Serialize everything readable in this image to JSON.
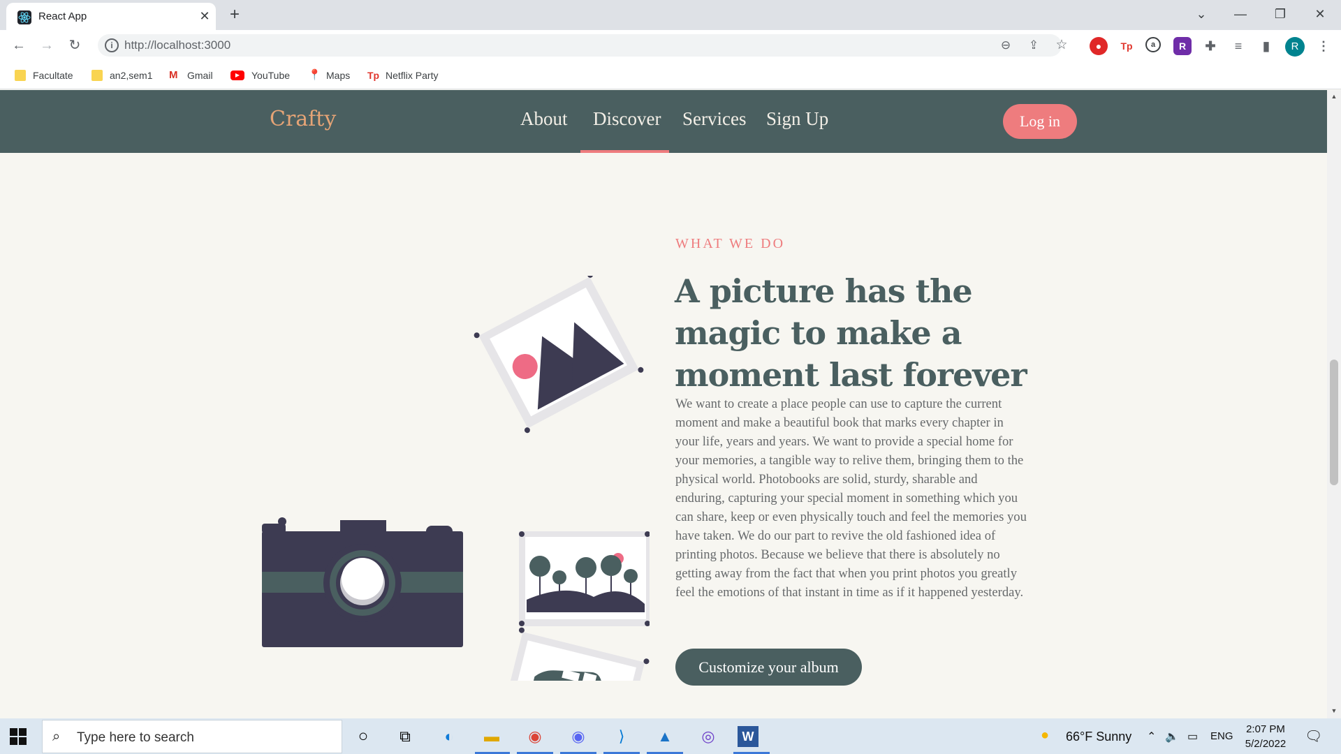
{
  "browser": {
    "tab_title": "React App",
    "url": "http://localhost:3000",
    "profile_initial": "R",
    "bookmarks": [
      "Facultate",
      "an2,sem1",
      "Gmail",
      "YouTube",
      "Maps",
      "Netflix Party"
    ]
  },
  "site": {
    "brand": "Crafty",
    "nav": [
      "About",
      "Discover",
      "Services",
      "Sign Up"
    ],
    "active_nav": "Discover",
    "login": "Log in"
  },
  "section": {
    "eyebrow": "WHAT WE DO",
    "headline": "A picture has the magic to make a moment last forever",
    "body": "We want to create a place people can use to capture the current moment and make a beautiful book that marks every chapter in your life, years and years. We want to provide a special home for your memories, a tangible way to relive them, bringing them to the physical world. Photobooks are solid, sturdy, sharable and enduring, capturing your special moment in something which you can share, keep or even physically touch and feel the memories you have taken. We do our part to revive the old fashioned idea of printing photos. Because we believe that there is absolutely no getting away from the fact that when you print photos you greatly feel the emotions of that instant in time as if it happened yesterday.",
    "cta": "Customize your album"
  },
  "taskbar": {
    "search_placeholder": "Type here to search",
    "weather": "66°F  Sunny",
    "language": "ENG",
    "time": "2:07 PM",
    "date": "5/2/2022"
  },
  "colors": {
    "nav_bg": "#4a5f60",
    "accent_pink": "#ee7c7e",
    "brand_orange": "#e6a476",
    "page_bg": "#f7f6f1",
    "ink_dark": "#3d3b52"
  },
  "icons": {
    "tab_favicon": "react-logo-icon",
    "photo_illustration": "camera-and-photos-icon"
  }
}
